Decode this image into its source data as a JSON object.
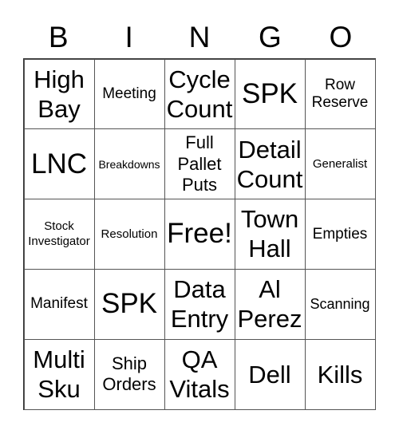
{
  "header": [
    "B",
    "I",
    "N",
    "G",
    "O"
  ],
  "cells": [
    {
      "text": "High Bay",
      "size": "s-l"
    },
    {
      "text": "Meeting",
      "size": "s-s"
    },
    {
      "text": "Cycle Count",
      "size": "s-l"
    },
    {
      "text": "SPK",
      "size": "s-xl"
    },
    {
      "text": "Row Reserve",
      "size": "s-s"
    },
    {
      "text": "LNC",
      "size": "s-xl"
    },
    {
      "text": "Breakdowns",
      "size": "s-t"
    },
    {
      "text": "Full Pallet Puts",
      "size": "s-ml"
    },
    {
      "text": "Detail Count",
      "size": "s-l"
    },
    {
      "text": "Generalist",
      "size": "s-xxs"
    },
    {
      "text": "Stock Investigator",
      "size": "s-xxs"
    },
    {
      "text": "Resolution",
      "size": "s-xxs"
    },
    {
      "text": "Free!",
      "size": "s-xl"
    },
    {
      "text": "Town Hall",
      "size": "s-l"
    },
    {
      "text": "Empties",
      "size": "s-s"
    },
    {
      "text": "Manifest",
      "size": "s-s"
    },
    {
      "text": "SPK",
      "size": "s-xl"
    },
    {
      "text": "Data Entry",
      "size": "s-l"
    },
    {
      "text": "Al Perez",
      "size": "s-l"
    },
    {
      "text": "Scanning",
      "size": "s-xs"
    },
    {
      "text": "Multi Sku",
      "size": "s-l"
    },
    {
      "text": "Ship Orders",
      "size": "s-ml"
    },
    {
      "text": "QA Vitals",
      "size": "s-l"
    },
    {
      "text": "Dell",
      "size": "s-l"
    },
    {
      "text": "Kills",
      "size": "s-l"
    }
  ]
}
